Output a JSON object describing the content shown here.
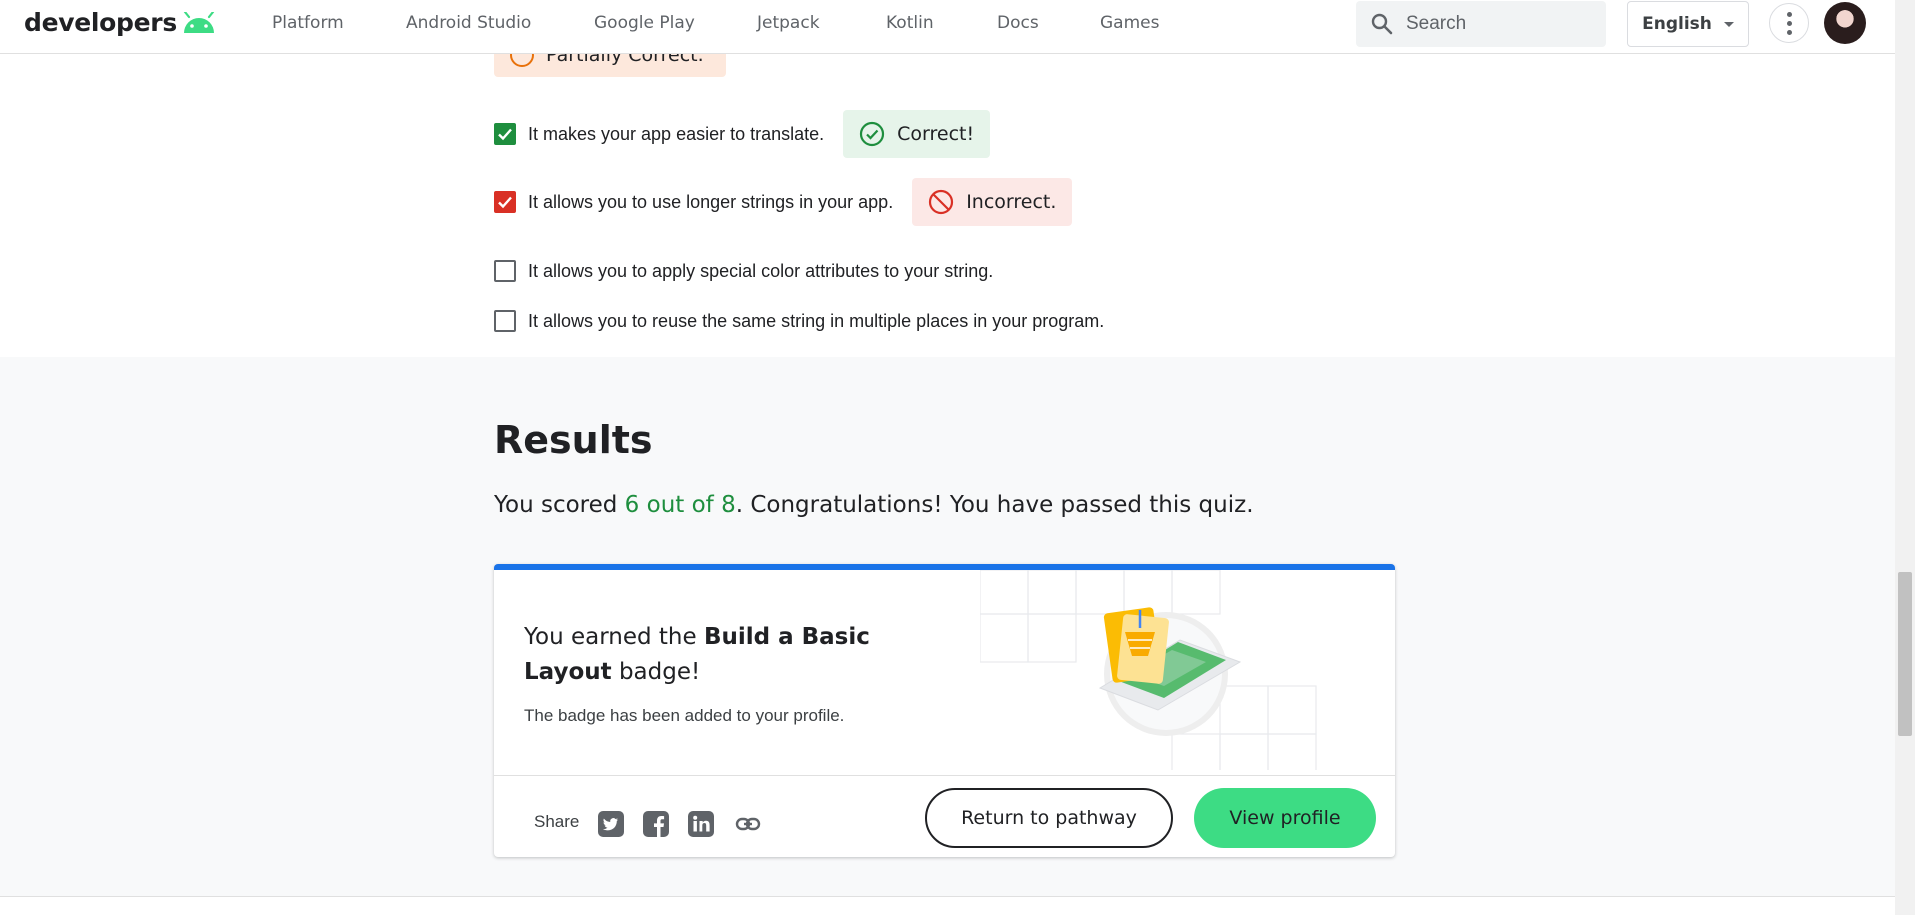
{
  "header": {
    "logo_text": "developers",
    "nav": [
      {
        "label": "Platform",
        "name": "nav-platform"
      },
      {
        "label": "Android Studio",
        "name": "nav-android-studio"
      },
      {
        "label": "Google Play",
        "name": "nav-google-play"
      },
      {
        "label": "Jetpack",
        "name": "nav-jetpack"
      },
      {
        "label": "Kotlin",
        "name": "nav-kotlin"
      },
      {
        "label": "Docs",
        "name": "nav-docs"
      },
      {
        "label": "Games",
        "name": "nav-games"
      }
    ],
    "search_placeholder": "Search",
    "language": "English"
  },
  "quiz": {
    "partial_feedback": "Partially Correct.",
    "options": [
      {
        "label": "It makes your app easier to translate.",
        "checked": true,
        "feedback": "Correct!",
        "state": "correct"
      },
      {
        "label": "It allows you to use longer strings in your app.",
        "checked": true,
        "feedback": "Incorrect.",
        "state": "incorrect"
      },
      {
        "label": "It allows you to apply special color attributes to your string.",
        "checked": false
      },
      {
        "label": "It allows you to reuse the same string in multiple places in your program.",
        "checked": false
      }
    ]
  },
  "results": {
    "title": "Results",
    "score_prefix": "You scored ",
    "score": "6 out of 8",
    "score_suffix": ". Congratulations! You have passed this quiz."
  },
  "badge": {
    "earned_prefix": "You earned the ",
    "badge_name": "Build a Basic Layout",
    "earned_suffix": " badge!",
    "added_text": "The badge has been added to your profile.",
    "share_label": "Share",
    "share_icons": [
      "twitter-icon",
      "facebook-icon",
      "linkedin-icon",
      "link-icon"
    ],
    "return_label": "Return to pathway",
    "view_label": "View profile"
  },
  "colors": {
    "android_green": "#3ddc84",
    "correct_green": "#1e8e3e",
    "incorrect_red": "#d93025",
    "partial_orange": "#e8710a",
    "card_accent_blue": "#1a73e8"
  }
}
